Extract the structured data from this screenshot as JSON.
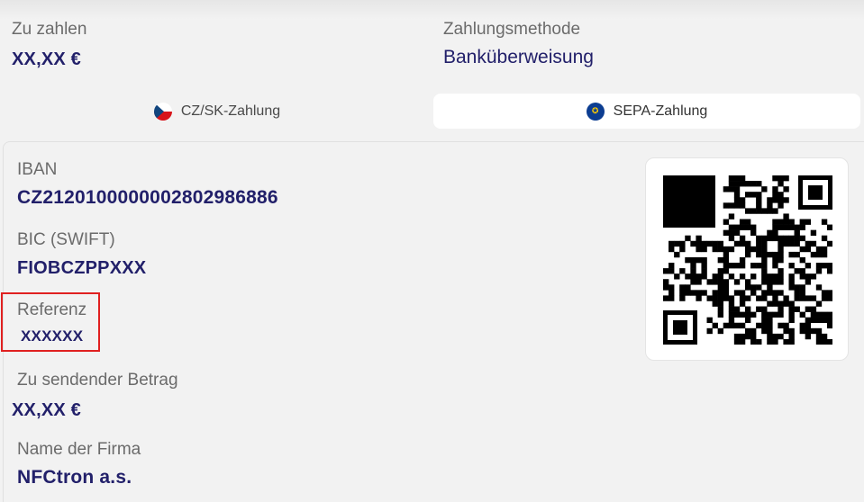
{
  "header": {
    "amount_label": "Zu zahlen",
    "amount_value": "XX,XX €",
    "method_label": "Zahlungsmethode",
    "method_value": "Banküberweisung"
  },
  "tabs": [
    {
      "label": "CZ/SK-Zahlung",
      "icon": "czech-flag-icon",
      "active": false
    },
    {
      "label": "SEPA-Zahlung",
      "icon": "eu-flag-icon",
      "active": true
    }
  ],
  "details": {
    "iban_label": "IBAN",
    "iban_value": "CZ2120100000002802986886",
    "bic_label": "BIC (SWIFT)",
    "bic_value": "FIOBCZPPXXX",
    "reference_label": "Referenz",
    "reference_value": "XXXXXX",
    "send_amount_label": "Zu sendender Betrag",
    "send_amount_value": "XX,XX €",
    "company_label": "Name der Firma",
    "company_value": "NFCtron a.s."
  },
  "qr": {
    "icon": "qr-code-icon"
  },
  "colors": {
    "accent": "#22206a",
    "highlight": "#e02020",
    "background": "#f2f2f2"
  }
}
